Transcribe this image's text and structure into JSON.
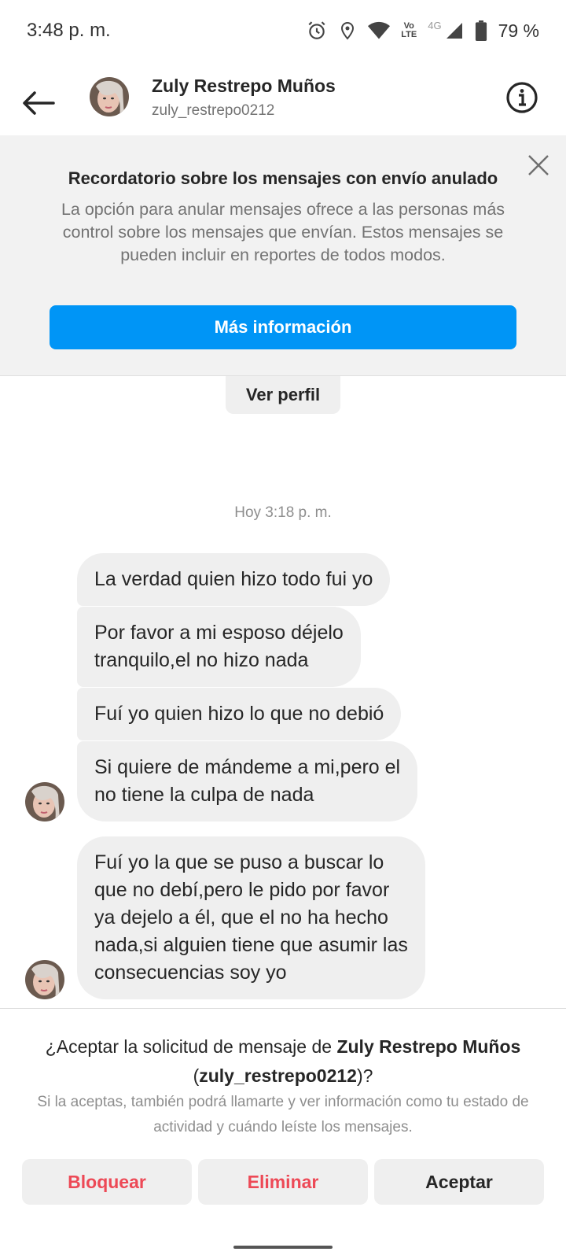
{
  "status_bar": {
    "time": "3:48 p. m.",
    "volte_line1": "Vo",
    "volte_line2": "LTE",
    "network": "4G",
    "battery": "79 %"
  },
  "header": {
    "name": "Zuly Restrepo Muños",
    "username": "zuly_restrepo0212"
  },
  "banner": {
    "title": "Recordatorio sobre los mensajes con envío anulado",
    "body": "La opción para anular mensajes ofrece a las personas más control sobre los mensajes que envían. Estos mensajes se pueden incluir en reportes de todos modos.",
    "button": "Más información"
  },
  "chat": {
    "view_profile": "Ver perfil",
    "timestamp": "Hoy 3:18 p. m.",
    "messages": [
      "La verdad quien hizo todo fui yo",
      "Por favor a mi esposo déjelo\ntranquilo,el no hizo nada",
      "Fuí yo quien hizo lo que no debió",
      "Si quiere de mándeme a mi,pero el\nno tiene la culpa de nada",
      "Fuí yo la que se puso a buscar lo\nque no debí,pero le pido por favor\nya dejelo a él, que el no ha hecho\nnada,si alguien tiene que asumir las\nconsecuencias soy yo"
    ]
  },
  "request": {
    "question_prefix": "¿Aceptar la solicitud de mensaje de ",
    "question_name": "Zuly Restrepo Muños",
    "question_open": " (",
    "question_username": "zuly_restrepo0212",
    "question_suffix": ")?",
    "info": "Si la aceptas, también podrá llamarte y ver información como tu estado de actividad y cuándo leíste los mensajes.",
    "block": "Bloquear",
    "delete": "Eliminar",
    "accept": "Aceptar"
  },
  "colors": {
    "accent_blue": "#0095f6",
    "danger_red": "#ed4956",
    "bubble_gray": "#efefef"
  },
  "icons": [
    "alarm-icon",
    "location-icon",
    "wifi-icon",
    "signal-icon",
    "battery-icon",
    "back-arrow-icon",
    "info-icon",
    "close-icon"
  ]
}
